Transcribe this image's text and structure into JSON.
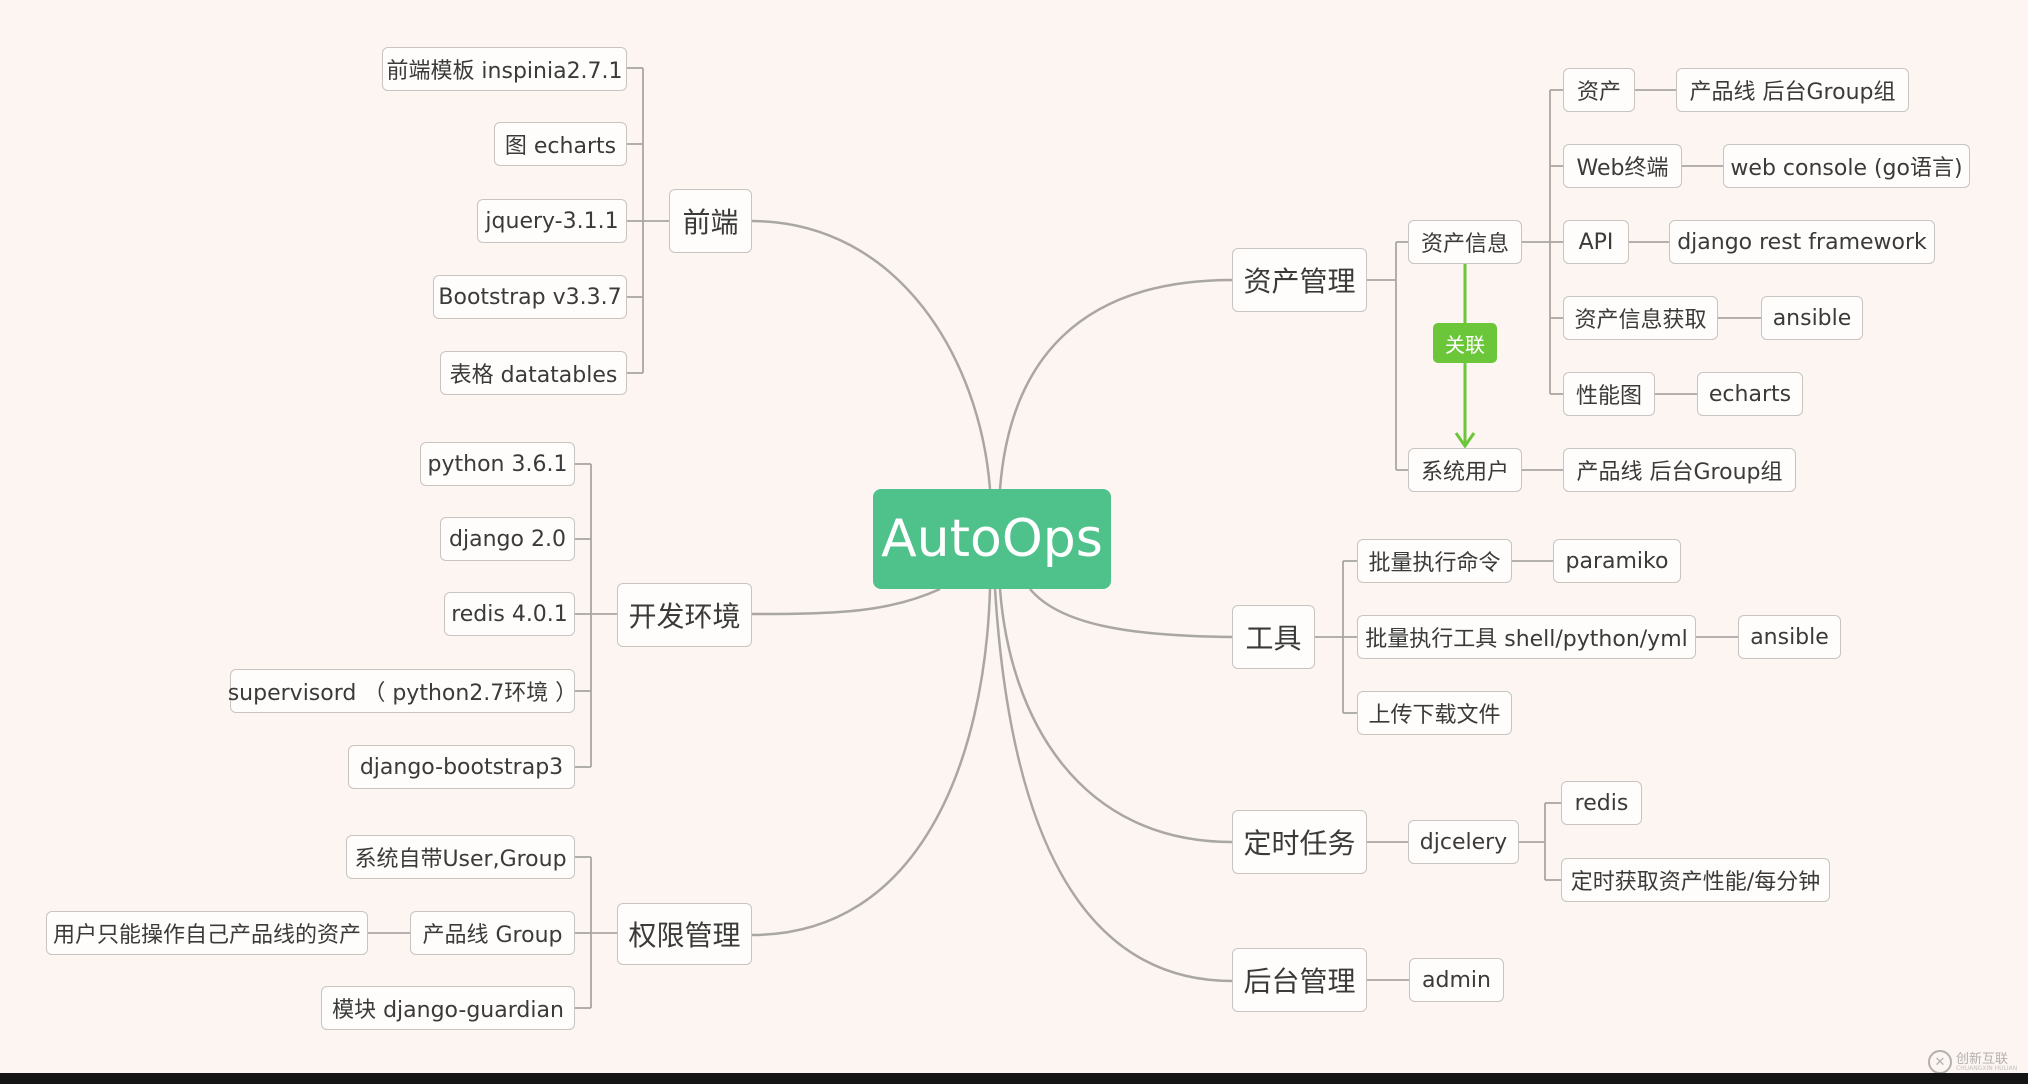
{
  "root": {
    "label": "AutoOps"
  },
  "branches": {
    "frontend": {
      "label": "前端",
      "children": [
        "前端模板 inspinia2.7.1",
        "图 echarts",
        "jquery-3.1.1",
        "Bootstrap v3.3.7",
        "表格 datatables"
      ]
    },
    "devenv": {
      "label": "开发环境",
      "children": [
        "python 3.6.1",
        "django 2.0",
        "redis 4.0.1",
        "supervisord （ python2.7环境 ）",
        "django-bootstrap3"
      ]
    },
    "perms": {
      "label": "权限管理",
      "children": [
        "系统自带User,Group",
        "产品线 Group",
        "模块 django-guardian"
      ],
      "productline_note": "用户只能操作自己产品线的资产"
    },
    "assets": {
      "label": "资产管理",
      "info": {
        "label": "资产信息",
        "items": [
          {
            "label": "资产",
            "detail": "产品线  后台Group组"
          },
          {
            "label": "Web终端",
            "detail": "web console (go语言)"
          },
          {
            "label": "API",
            "detail": "django rest framework"
          },
          {
            "label": "资产信息获取",
            "detail": "ansible"
          },
          {
            "label": "性能图",
            "detail": "echarts"
          }
        ]
      },
      "sysuser": {
        "label": "系统用户",
        "detail": "产品线  后台Group组"
      },
      "relation_label": "关联"
    },
    "tools": {
      "label": "工具",
      "items": [
        {
          "label": "批量执行命令",
          "detail": "paramiko"
        },
        {
          "label": "批量执行工具 shell/python/yml",
          "detail": "ansible"
        },
        {
          "label": "上传下载文件"
        }
      ]
    },
    "cron": {
      "label": "定时任务",
      "engine": {
        "label": "djcelery",
        "children": [
          "redis",
          "定时获取资产性能/每分钟"
        ]
      }
    },
    "admin": {
      "label": "后台管理",
      "child": "admin"
    }
  },
  "watermark": {
    "cn": "创新互联",
    "en": "CHUANGXIN HULIAN"
  },
  "colors": {
    "background": "#fcf5f1",
    "root": "#4fc28b",
    "relation": "#6cc63a",
    "node_border": "#c9c4c0",
    "connector": "#a9a6a3",
    "text": "#3a3a3a"
  }
}
